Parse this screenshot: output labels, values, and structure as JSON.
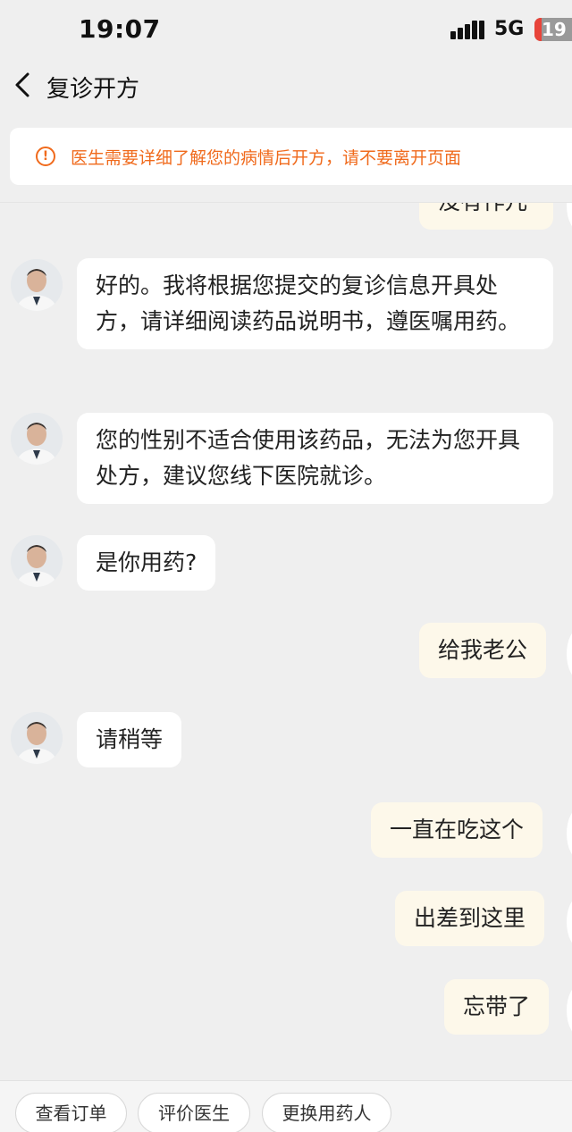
{
  "status_bar": {
    "time": "19:07",
    "network": "5G",
    "battery": "19"
  },
  "header": {
    "title": "复诊开方",
    "back_icon": "chevron-left-icon"
  },
  "notice": {
    "text": "医生需要详细了解您的病情后开方，请不要离开页面",
    "icon": "warning-circle-icon",
    "color": "#f06a1c"
  },
  "messages": [
    {
      "from": "patient",
      "text": "没有作儿"
    },
    {
      "from": "doctor",
      "text": "好的。我将根据您提交的复诊信息开具处方，请详细阅读药品说明书，遵医嘱用药。"
    },
    {
      "from": "doctor",
      "text": "您的性别不适合使用该药品，无法为您开具处方，建议您线下医院就诊。"
    },
    {
      "from": "doctor",
      "text": "是你用药?"
    },
    {
      "from": "patient",
      "text": "给我老公"
    },
    {
      "from": "doctor",
      "text": "请稍等"
    },
    {
      "from": "patient",
      "text": "一直在吃这个"
    },
    {
      "from": "patient",
      "text": "出差到这里"
    },
    {
      "from": "patient",
      "text": "忘带了"
    }
  ],
  "actions": [
    {
      "label": "查看订单"
    },
    {
      "label": "评价医生"
    },
    {
      "label": "更换用药人"
    }
  ],
  "colors": {
    "patient_bubble": "#fdf8ea",
    "doctor_bubble": "#ffffff",
    "background": "#efefef"
  }
}
